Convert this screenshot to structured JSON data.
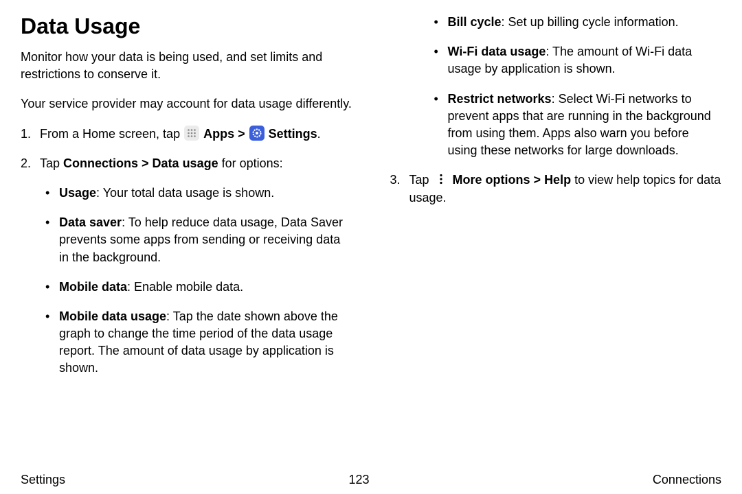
{
  "heading": "Data Usage",
  "intro1": "Monitor how your data is being used, and set limits and restrictions to conserve it.",
  "intro2": "Your service provider may account for data usage differently.",
  "step1": {
    "prefix": "From a Home screen, tap ",
    "apps": "Apps",
    "sep": " > ",
    "settings": "Settings",
    "suffix": "."
  },
  "step2": {
    "prefix": "Tap ",
    "strong": "Connections > Data usage",
    "suffix": " for options:"
  },
  "bullets_left": {
    "usage": {
      "label": "Usage",
      "text": ": Your total data usage is shown."
    },
    "datasaver": {
      "label": "Data saver",
      "text": ": To help reduce data usage, Data Saver prevents some apps from sending or receiving data in the background."
    },
    "mobiledata": {
      "label": "Mobile data",
      "text": ": Enable mobile data."
    },
    "mobileusage": {
      "label": "Mobile data usage",
      "text": ": Tap the date shown above the graph to change the time period of the data usage report. The amount of data usage by application is shown."
    }
  },
  "bullets_right": {
    "billcycle": {
      "label": "Bill cycle",
      "text": ": Set up billing cycle information."
    },
    "wifi": {
      "label": "Wi-Fi data usage",
      "text": ": The amount of Wi-Fi data usage by application is shown."
    },
    "restrict": {
      "label": "Restrict networks",
      "text": ": Select Wi-Fi networks to prevent apps that are running in the background from using them. Apps also warn you before using these networks for large downloads."
    }
  },
  "step3": {
    "prefix": "Tap ",
    "strong1": "More options",
    "sep": " > ",
    "strong2": "Help",
    "suffix": " to view help topics for data usage."
  },
  "footer": {
    "left": "Settings",
    "center": "123",
    "right": "Connections"
  }
}
